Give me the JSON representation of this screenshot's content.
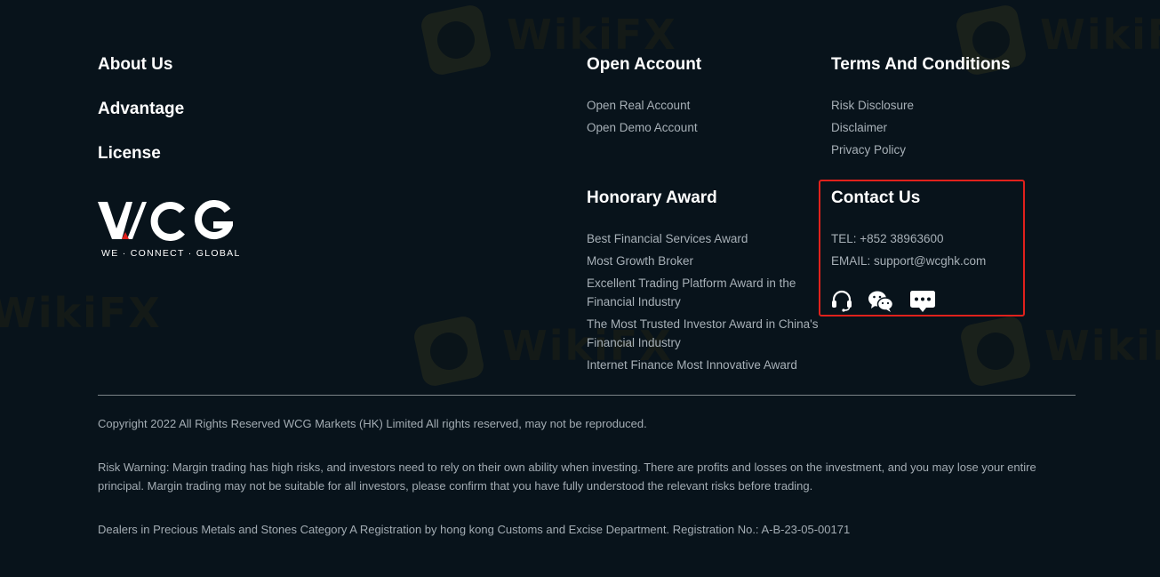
{
  "left_nav": {
    "about": "About Us",
    "advantage": "Advantage",
    "license": "License"
  },
  "logo": {
    "wordmark": "WCG",
    "tagline": "WE · CONNECT · GLOBAL",
    "accent_color": "#e0211c"
  },
  "open_account": {
    "title": "Open Account",
    "links": [
      "Open Real Account",
      "Open Demo Account"
    ]
  },
  "terms": {
    "title": "Terms And Conditions",
    "links": [
      "Risk Disclosure",
      "Disclaimer",
      "Privacy Policy"
    ]
  },
  "honorary": {
    "title": "Honorary Award",
    "items": [
      "Best Financial Services Award",
      "Most Growth Broker",
      "Excellent Trading Platform Award in the Financial Industry",
      "The Most Trusted Investor Award in China's Financial Industry",
      "Internet Finance Most Innovative Award"
    ]
  },
  "contact": {
    "title": "Contact Us",
    "tel": "TEL: +852 38963600",
    "email": "EMAIL: support@wcghk.com",
    "icons": [
      "headset-icon",
      "wechat-icon",
      "chat-bubble-icon"
    ],
    "highlight_color": "#e0211c"
  },
  "footer": {
    "copyright": "Copyright 2022 All Rights Reserved WCG Markets (HK) Limited All rights reserved, may not be reproduced.",
    "risk_warning": "Risk Warning: Margin trading has high risks, and investors need to rely on their own ability when investing. There are profits and losses on the investment, and you may lose your entire principal. Margin trading may not be suitable for all investors, please confirm that you have fully understood the relevant risks before trading.",
    "registration": "Dealers in Precious Metals and Stones Category A Registration by hong kong Customs and Excise Department. Registration No.: A-B-23-05-00171"
  },
  "watermark": {
    "text": "WikiFX"
  }
}
